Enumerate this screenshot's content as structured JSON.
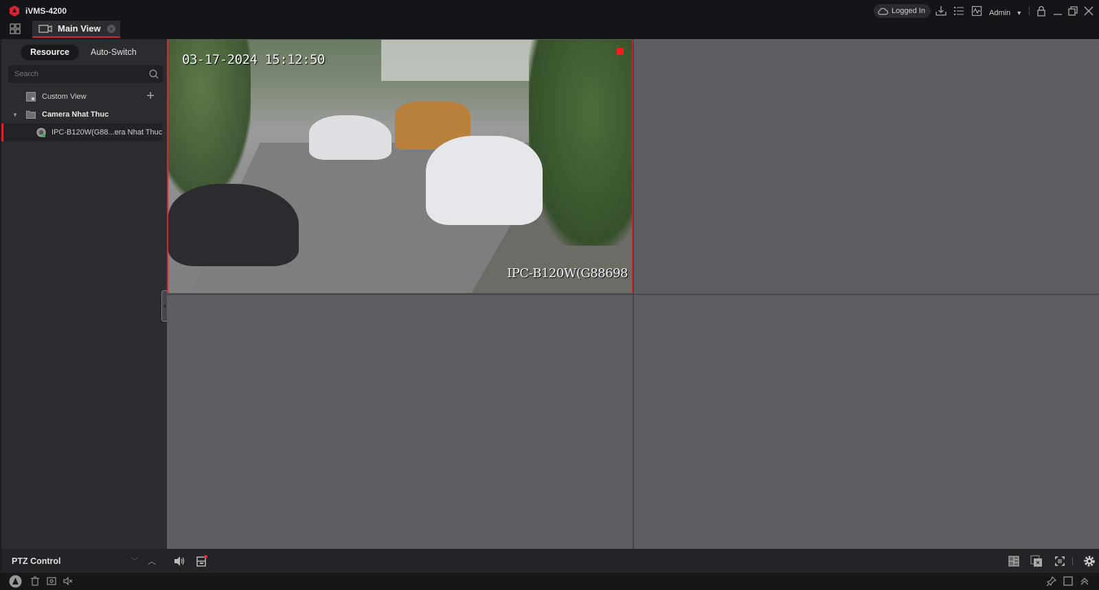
{
  "app": {
    "title": "iVMS-4200",
    "brand_color": "#d9232d"
  },
  "tabs": [
    {
      "label": "Main View",
      "active": true
    }
  ],
  "topbar": {
    "status_label": "Logged In",
    "user_label": "Admin",
    "icons": [
      "cloud-icon",
      "download-icon",
      "task-list-icon",
      "health-monitor-icon",
      "chevron-down-icon",
      "lock-icon",
      "minimize-icon",
      "restore-icon",
      "close-icon"
    ]
  },
  "sidebar": {
    "segments": {
      "resource": "Resource",
      "auto_switch": "Auto-Switch"
    },
    "search": {
      "placeholder": "Search",
      "value": ""
    },
    "tree": [
      {
        "label": "Custom View",
        "level": 0,
        "icon": "custom-view-icon"
      },
      {
        "label": "Camera Nhat Thuc",
        "level": 0,
        "icon": "folder-icon",
        "expanded": true
      },
      {
        "label": "IPC-B120W(G88...era Nhat Thuc",
        "level": 1,
        "icon": "camera-icon",
        "selected": true
      }
    ],
    "ptz_label": "PTZ Control"
  },
  "video": {
    "osd_time": "03-17-2024 15:12:50",
    "osd_name": "IPC-B120W(G88698",
    "recording": true,
    "layout": "2x2"
  },
  "bottombar": {
    "left_icons": [
      "audio-icon",
      "record-icon"
    ],
    "right_icons": [
      "window-layout-icon",
      "close-all-windows-icon",
      "fullscreen-icon",
      "settings-icon"
    ]
  },
  "statusbar": {
    "left_icons": [
      "alarm-icon",
      "delete-icon",
      "event-icon",
      "mute-icon"
    ],
    "right_icons": [
      "pin-icon",
      "window-icon",
      "expand-up-icon"
    ]
  }
}
